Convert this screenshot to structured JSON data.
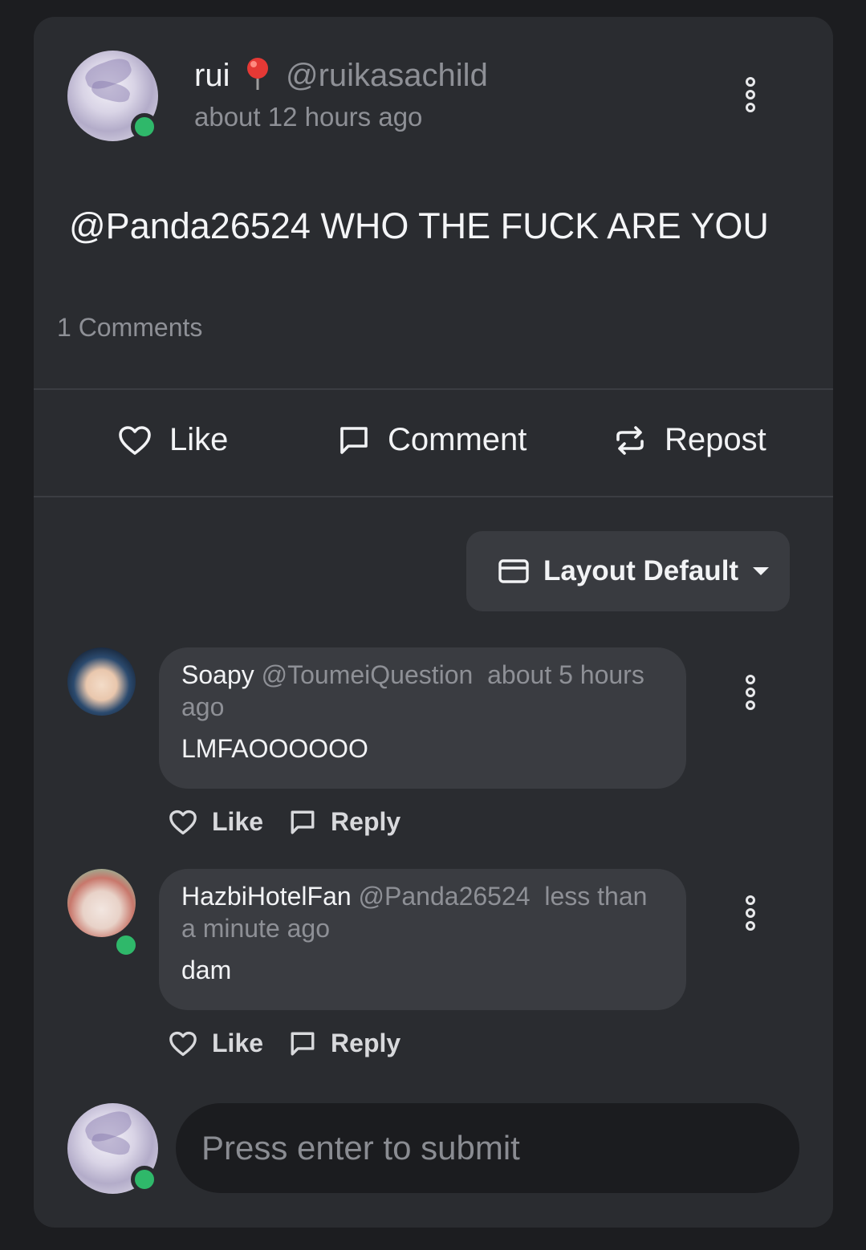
{
  "post": {
    "author_name": "rui",
    "author_emoji": "📍",
    "author_handle": "@ruikasachild",
    "timestamp": "about 12 hours ago",
    "body": "@Panda26524 WHO THE FUCK ARE YOU",
    "comments_count": "1 Comments"
  },
  "actions": {
    "like": "Like",
    "comment": "Comment",
    "repost": "Repost"
  },
  "layout_selector": {
    "label": "Layout Default"
  },
  "comments": [
    {
      "name": "Soapy",
      "handle": "@ToumeiQuestion",
      "time": "about 5 hours ago",
      "text": "LMFAOOOOOO",
      "like": "Like",
      "reply": "Reply"
    },
    {
      "name": "HazbiHotelFan",
      "handle": "@Panda26524",
      "time": "less than a minute ago",
      "text": "dam",
      "like": "Like",
      "reply": "Reply"
    }
  ],
  "composer": {
    "placeholder": "Press enter to submit"
  },
  "colors": {
    "background": "#1c1d20",
    "card": "#2a2c30",
    "online": "#2fb86a",
    "muted_text": "#8e9096"
  }
}
